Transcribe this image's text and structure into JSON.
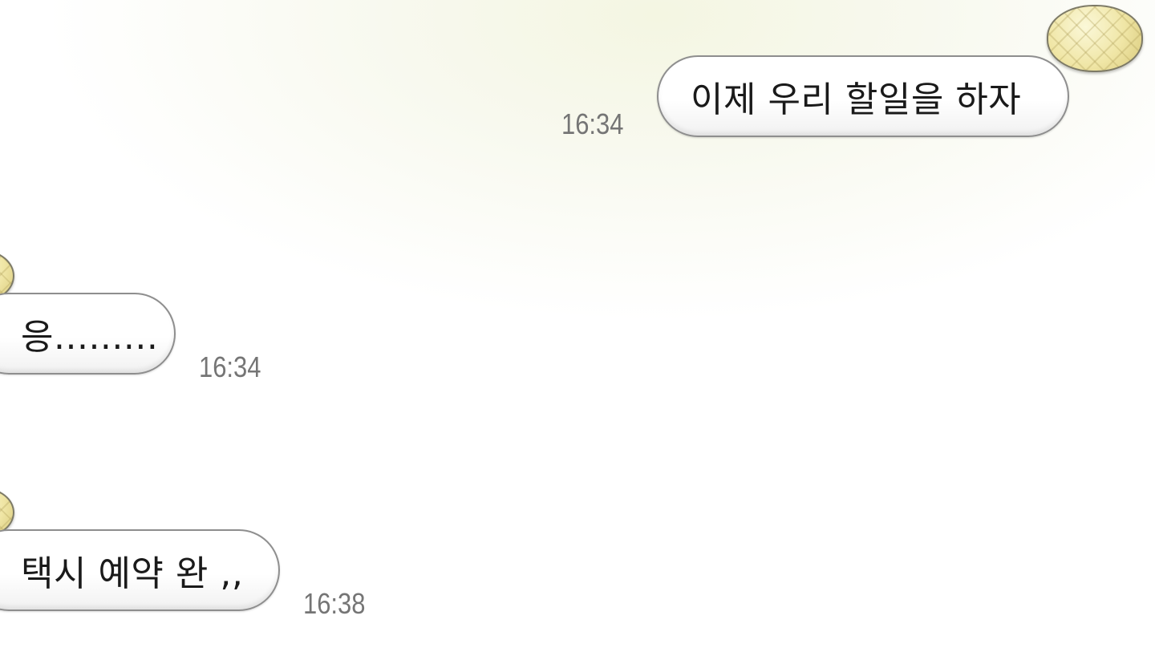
{
  "messages": [
    {
      "direction": "outgoing",
      "text": "이제 우리 할일을 하자",
      "time": "16:34"
    },
    {
      "direction": "incoming",
      "text": "응.........",
      "time": "16:34"
    },
    {
      "direction": "incoming",
      "text": "택시 예약 완 ,,",
      "time": "16:38"
    }
  ],
  "avatars": {
    "me": "melon-bread-avatar",
    "peer": "melon-bread-avatar"
  },
  "colors": {
    "background_tint": "#f4f6e2",
    "bubble_fill": "#ffffff",
    "bubble_border": "#8e8e8e",
    "timestamp_text": "#757575",
    "message_text": "#1a1a1a"
  }
}
